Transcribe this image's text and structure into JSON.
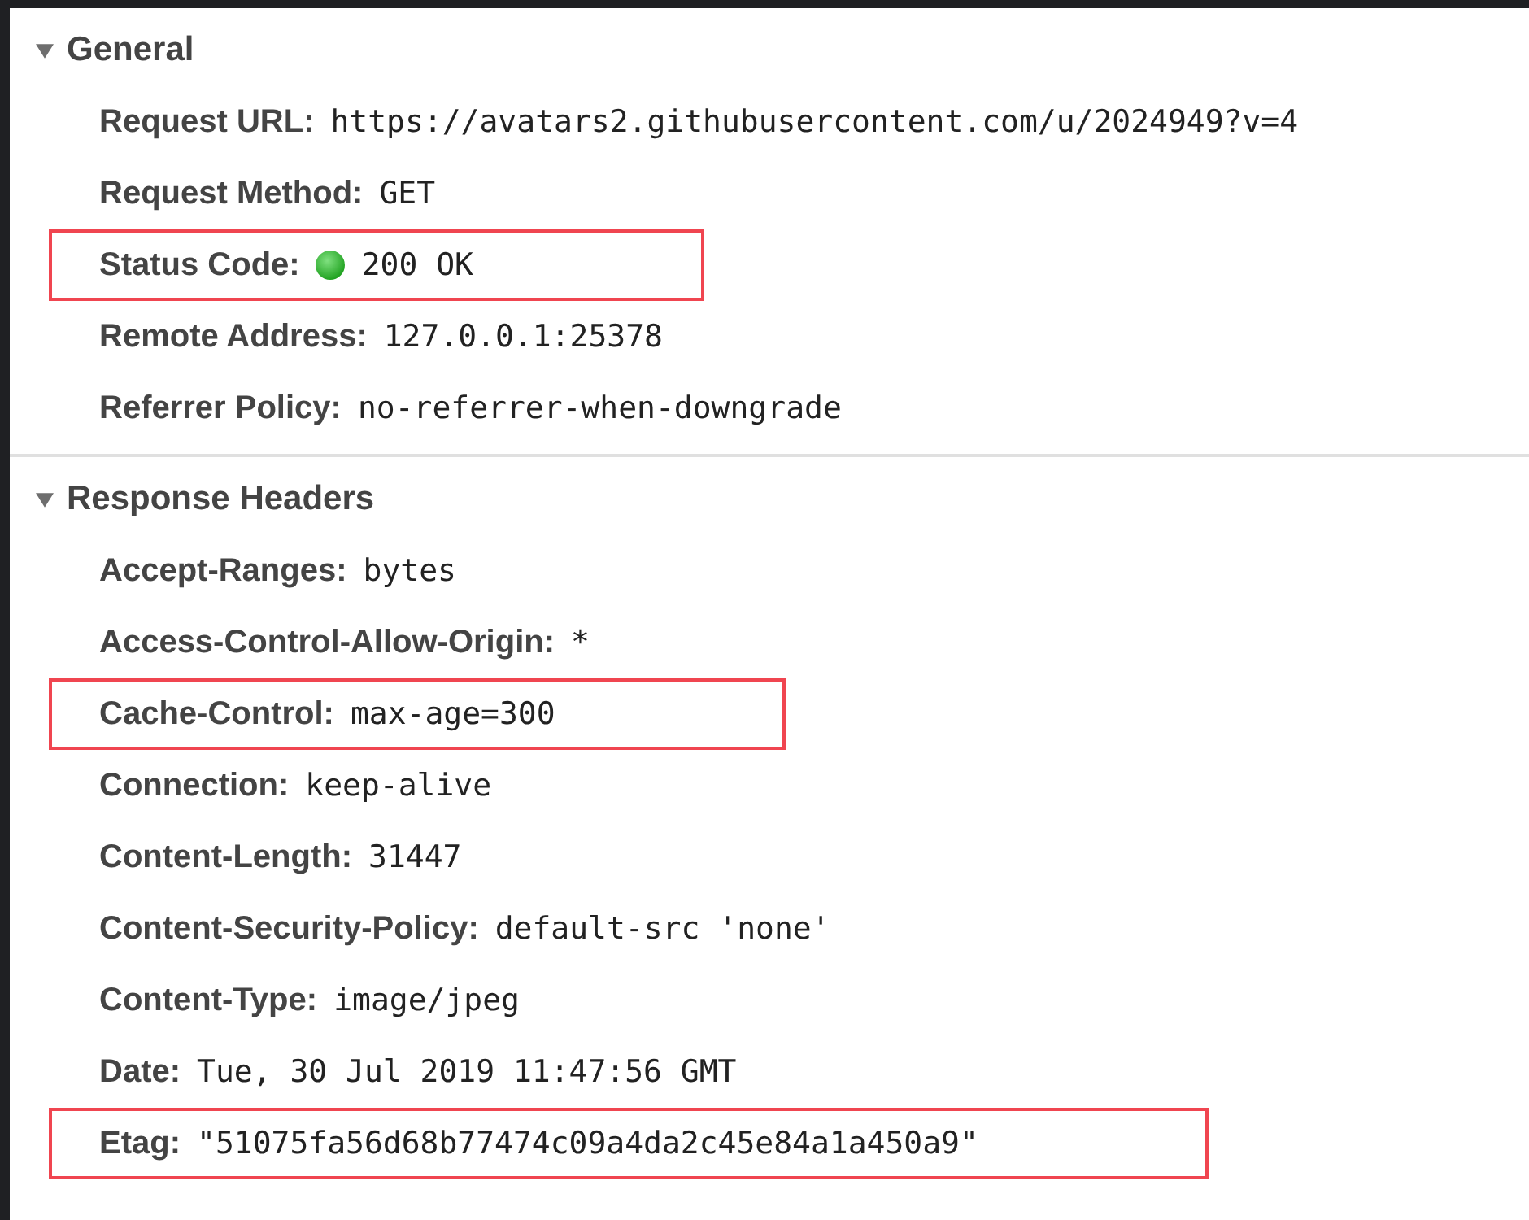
{
  "sections": [
    {
      "title": "General",
      "expanded": true,
      "rows": [
        {
          "kind": "plain",
          "name": "Request URL:",
          "value": "https://avatars2.githubusercontent.com/u/2024949?v=4",
          "highlighted": false
        },
        {
          "kind": "plain",
          "name": "Request Method:",
          "value": "GET",
          "highlighted": false
        },
        {
          "kind": "status",
          "name": "Status Code:",
          "value": "200 OK",
          "highlighted": true
        },
        {
          "kind": "plain",
          "name": "Remote Address:",
          "value": "127.0.0.1:25378",
          "highlighted": false
        },
        {
          "kind": "plain",
          "name": "Referrer Policy:",
          "value": "no-referrer-when-downgrade",
          "highlighted": false
        }
      ]
    },
    {
      "title": "Response Headers",
      "expanded": true,
      "rows": [
        {
          "kind": "plain",
          "name": "Accept-Ranges:",
          "value": "bytes",
          "highlighted": false
        },
        {
          "kind": "plain",
          "name": "Access-Control-Allow-Origin:",
          "value": "*",
          "highlighted": false
        },
        {
          "kind": "plain",
          "name": "Cache-Control:",
          "value": "max-age=300",
          "highlighted": true
        },
        {
          "kind": "plain",
          "name": "Connection:",
          "value": "keep-alive",
          "highlighted": false
        },
        {
          "kind": "plain",
          "name": "Content-Length:",
          "value": "31447",
          "highlighted": false
        },
        {
          "kind": "plain",
          "name": "Content-Security-Policy:",
          "value": "default-src 'none'",
          "highlighted": false
        },
        {
          "kind": "plain",
          "name": "Content-Type:",
          "value": "image/jpeg",
          "highlighted": false
        },
        {
          "kind": "plain",
          "name": "Date:",
          "value": "Tue, 30 Jul 2019 11:47:56 GMT",
          "highlighted": false
        },
        {
          "kind": "plain",
          "name": "Etag:",
          "value": "\"51075fa56d68b77474c09a4da2c45e84a1a450a9\"",
          "highlighted": true
        }
      ]
    }
  ]
}
